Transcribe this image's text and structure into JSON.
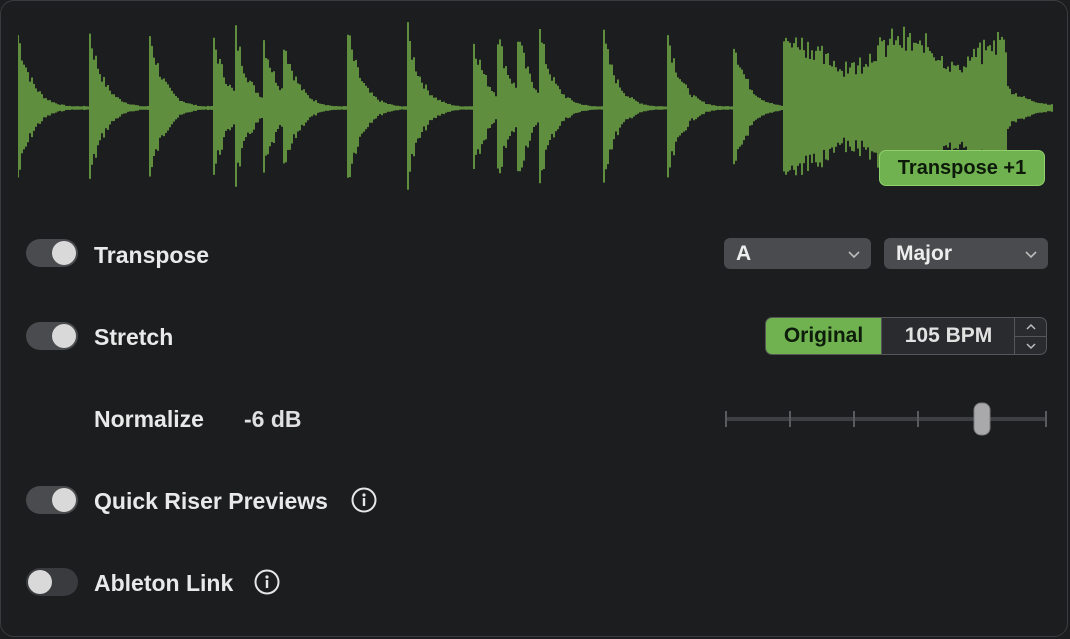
{
  "waveform": {
    "color": "#5f8f3e",
    "badge_label": "Transpose +1"
  },
  "transpose": {
    "label": "Transpose",
    "enabled": true,
    "key": "A",
    "scale": "Major"
  },
  "stretch": {
    "label": "Stretch",
    "enabled": true,
    "original_label": "Original",
    "bpm_label": "105 BPM"
  },
  "normalize": {
    "label": "Normalize",
    "value_label": "-6 dB",
    "slider_ticks": 6,
    "slider_position_fraction": 0.8
  },
  "quick_riser": {
    "label": "Quick Riser Previews",
    "enabled": true
  },
  "ableton_link": {
    "label": "Ableton Link",
    "enabled": false
  },
  "colors": {
    "accent": "#6fb24f",
    "background": "#1c1d1f"
  }
}
